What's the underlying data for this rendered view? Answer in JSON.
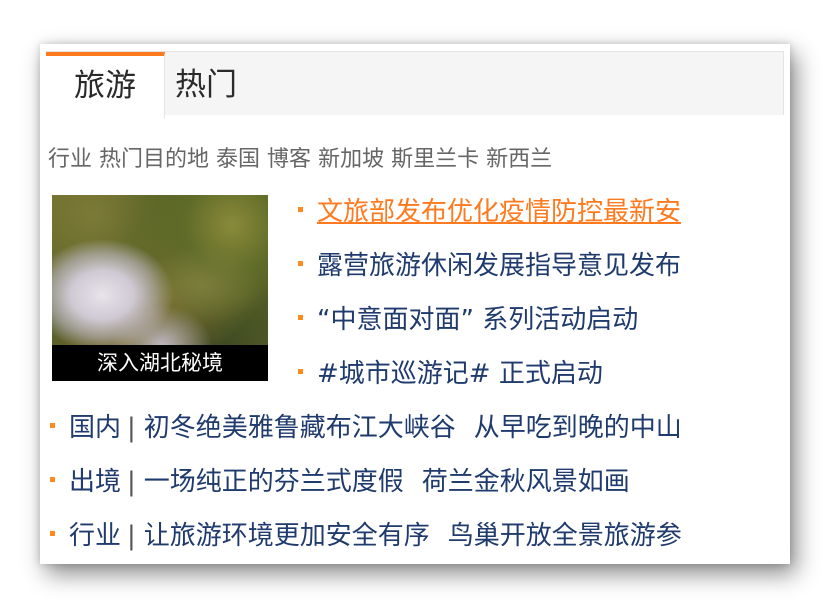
{
  "tabs": [
    {
      "label": "旅游",
      "active": true
    },
    {
      "label": "热门",
      "active": false
    }
  ],
  "accent_color": "#ff7a1e",
  "link_color": "#1f3a6d",
  "subnav": [
    "行业",
    "热门目的地",
    "泰国",
    "博客",
    "新加坡",
    "斯里兰卡",
    "新西兰"
  ],
  "feature": {
    "image_icon": "forest-aerial-image",
    "caption": "深入湖北秘境"
  },
  "headlines": [
    {
      "text": "文旅部发布优化疫情防控最新安",
      "highlight": true
    },
    {
      "text": "露营旅游休闲发展指导意见发布",
      "highlight": false
    },
    {
      "text": "“中意面对面” 系列活动启动",
      "highlight": false
    },
    {
      "text": "#城市巡游记#  正式启动",
      "highlight": false
    }
  ],
  "category_rows": [
    {
      "category": "国内",
      "separator": "|",
      "items": [
        "初冬绝美雅鲁藏布江大峡谷",
        "从早吃到晚的中山"
      ]
    },
    {
      "category": "出境",
      "separator": "|",
      "items": [
        "一场纯正的芬兰式度假",
        "荷兰金秋风景如画"
      ]
    },
    {
      "category": "行业",
      "separator": "|",
      "items": [
        "让旅游环境更加安全有序",
        "鸟巢开放全景旅游参"
      ]
    }
  ]
}
